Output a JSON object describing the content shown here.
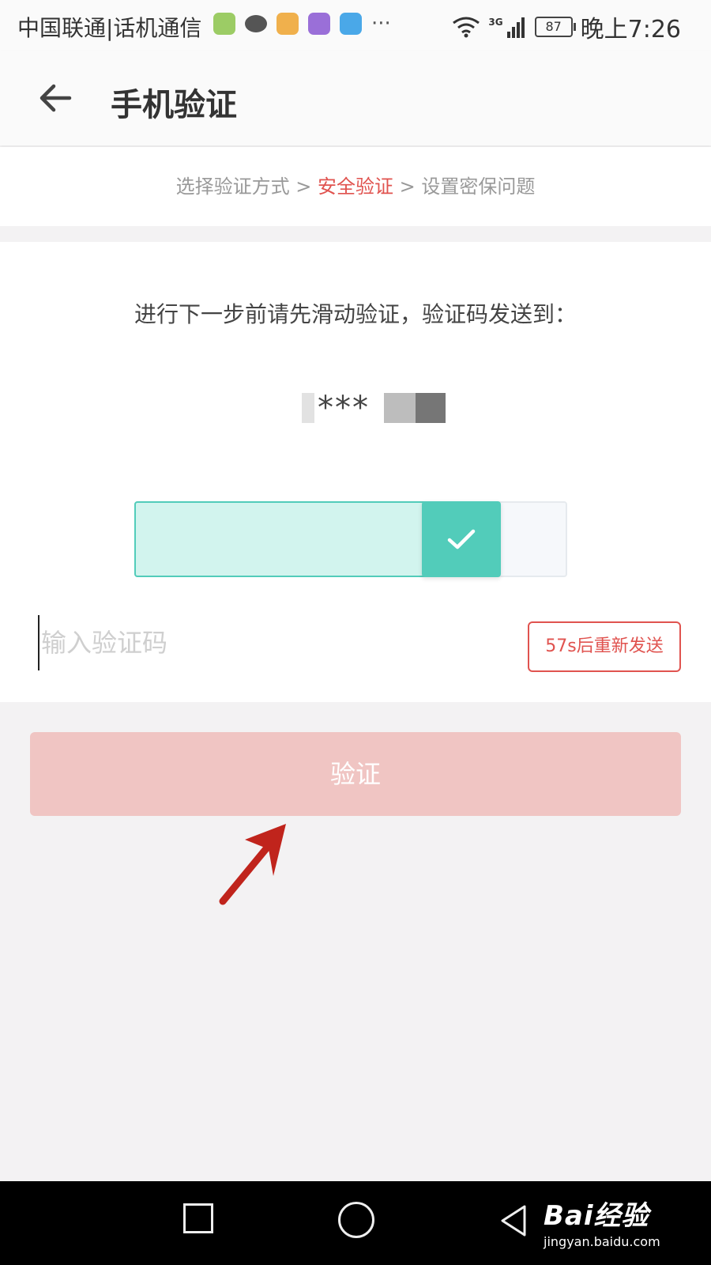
{
  "status_bar": {
    "carrier": "中国联通|话机通信",
    "network_type": "3G",
    "battery": "87",
    "time": "晚上7:26",
    "icons": [
      "leaf-app-icon",
      "chat-icon",
      "package-icon",
      "pie-app-icon",
      "shield-app-icon",
      "more-notifications-icon",
      "wifi-icon",
      "signal-icon",
      "battery-icon"
    ]
  },
  "header": {
    "title": "手机验证",
    "back_icon": "arrow-left-icon"
  },
  "steps": [
    {
      "label": "选择验证方式",
      "active": false
    },
    {
      "label": "安全验证",
      "active": true
    },
    {
      "label": "设置密保问题",
      "active": false
    }
  ],
  "steps_separator": " > ",
  "main": {
    "instruction": "进行下一步前请先滑动验证，验证码发送到：",
    "masked_phone": "***",
    "slider": {
      "state": "verified",
      "progress": 1.0,
      "handle_icon": "check-icon",
      "colors": {
        "fill": "#d2f4ee",
        "handle": "#52ccba",
        "border": "#52ccba"
      }
    },
    "code_input": {
      "placeholder": "输入验证码",
      "value": ""
    },
    "resend_button": "57s后重新发送",
    "verify_button": "验证"
  },
  "colors": {
    "accent": "#e0534f",
    "verify_button_disabled": "#f0c5c3",
    "annotation_arrow": "#c0241c"
  },
  "nav_bar": {
    "icons": [
      "recent-apps-icon",
      "home-icon",
      "back-triangle-icon"
    ]
  },
  "watermark": {
    "logo": "Bai经验",
    "url": "jingyan.baidu.com"
  }
}
